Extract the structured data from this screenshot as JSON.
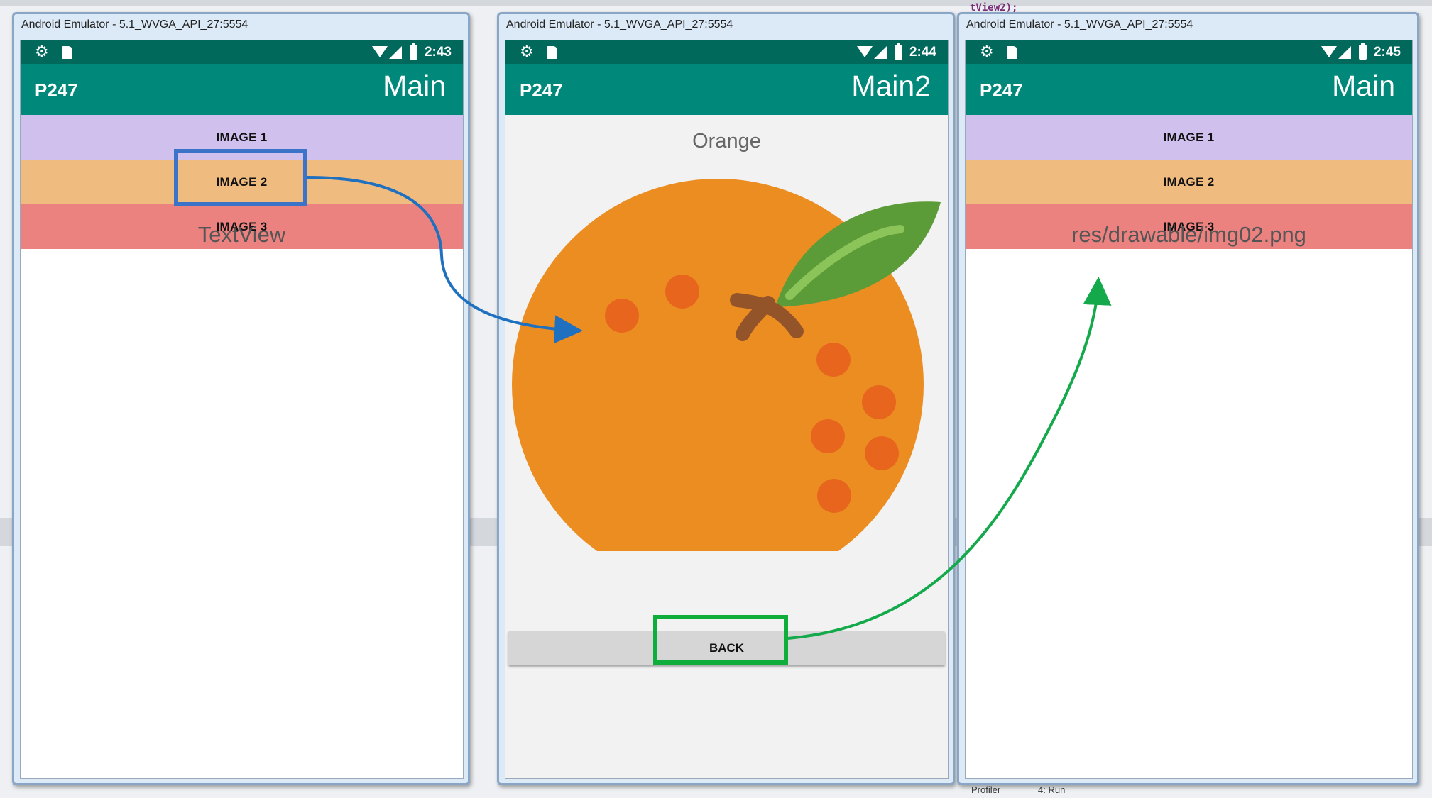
{
  "background": {
    "code_fragment": "tView2);",
    "profiler_label": "Profiler",
    "run_label": "4: Run"
  },
  "emulators": [
    {
      "title": "Android Emulator - 5.1_WVGA_API_27:5554",
      "time": "2:43",
      "app_name": "P247",
      "activity": "Main",
      "buttons": [
        "IMAGE 1",
        "IMAGE 2",
        "IMAGE 3"
      ],
      "textview": "TextView"
    },
    {
      "title": "Android Emulator - 5.1_WVGA_API_27:5554",
      "time": "2:44",
      "app_name": "P247",
      "activity": "Main2",
      "image_label": "Orange",
      "back_button": "BACK"
    },
    {
      "title": "Android Emulator - 5.1_WVGA_API_27:5554",
      "time": "2:45",
      "app_name": "P247",
      "activity": "Main",
      "buttons": [
        "IMAGE 1",
        "IMAGE 2",
        "IMAGE 3"
      ],
      "textview": "res/drawable/img02.png"
    }
  ],
  "colors": {
    "status_bar": "#00695c",
    "app_bar": "#00897b",
    "image1": "#cfc0ee",
    "image2": "#efbb7f",
    "image3": "#ec8280",
    "orange": "#ec8d22",
    "spot": "#e8651e",
    "leaf": "#5c9c38",
    "stem": "#94542a",
    "highlight_blue": "#3b73c8",
    "highlight_green": "#0fae3b"
  },
  "icons": [
    "gear-icon",
    "sd-card-icon",
    "wifi-icon",
    "signal-icon",
    "battery-icon",
    "orange-image"
  ]
}
